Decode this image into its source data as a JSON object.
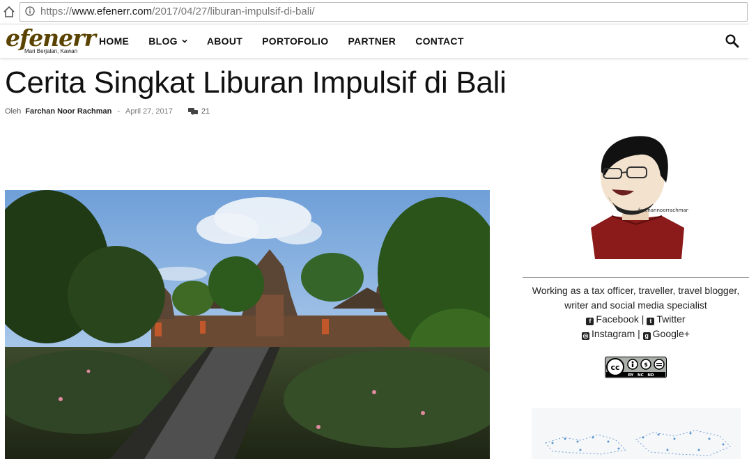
{
  "browser": {
    "url_prefix": "https://",
    "url_domain": "www.efenerr.com",
    "url_path": "/2017/04/27/liburan-impulsif-di-bali/"
  },
  "site": {
    "logo_text": "efenerr",
    "tagline": "Mari Berjalan, Kawan"
  },
  "nav": {
    "items": [
      {
        "label": "HOME"
      },
      {
        "label": "BLOG"
      },
      {
        "label": "ABOUT"
      },
      {
        "label": "PORTOFOLIO"
      },
      {
        "label": "PARTNER"
      },
      {
        "label": "CONTACT"
      }
    ]
  },
  "article": {
    "title": "Cerita Singkat Liburan Impulsif di Bali",
    "by_label": "Oleh",
    "author": "Farchan Noor Rachman",
    "separator": "-",
    "date": "April 27, 2017",
    "comment_count": "21"
  },
  "sidebar": {
    "avatar_caption": "farchannoorrachman",
    "bio": "Working as a tax officer, traveller, travel blogger, writer and social media specialist",
    "social": {
      "facebook": "Facebook",
      "twitter": "Twitter",
      "instagram": "Instagram",
      "googleplus": "Google+",
      "divider": "|"
    },
    "license_badge": {
      "cc": "cc",
      "labels": "BY   NC   ND"
    }
  },
  "colors": {
    "logo": "#5a4300",
    "nav_text": "#111111",
    "shirt": "#8b1a1a"
  }
}
